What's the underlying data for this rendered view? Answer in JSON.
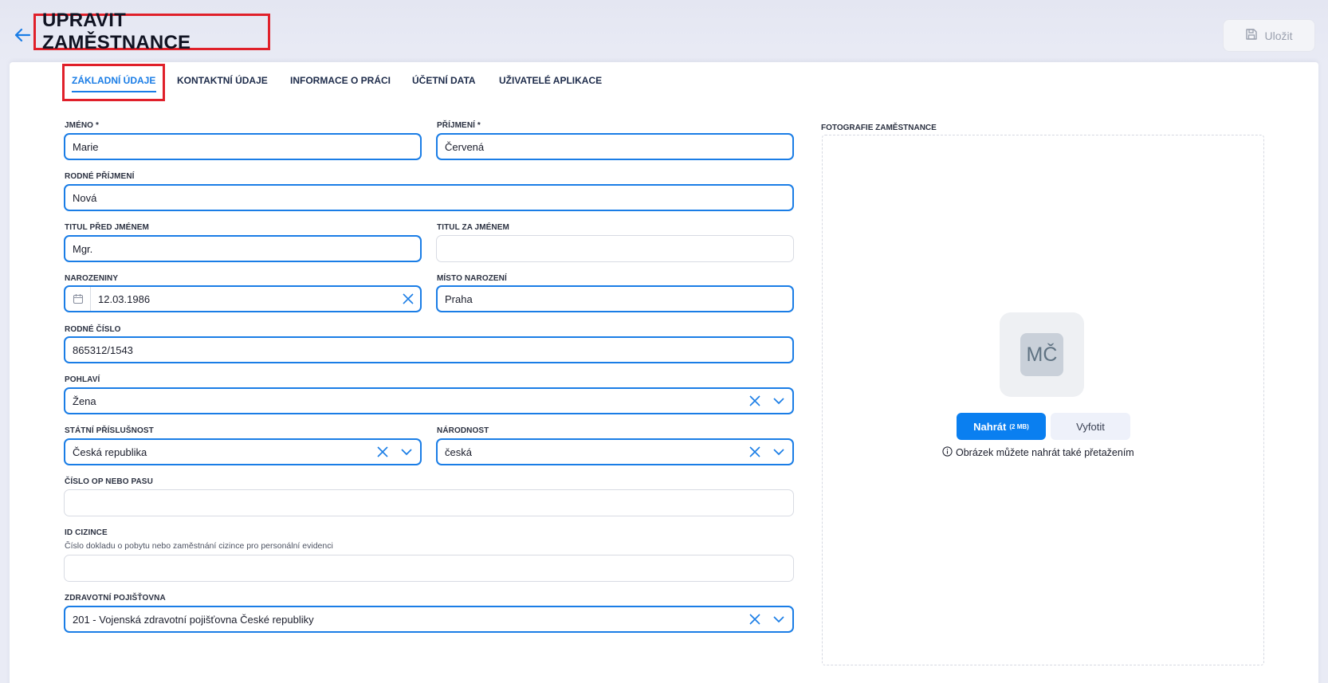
{
  "header": {
    "title": "UPRAVIT ZAMĚSTNANCE",
    "save_label": "Uložit"
  },
  "tabs": [
    {
      "label": "ZÁKLADNÍ ÚDAJE",
      "active": true
    },
    {
      "label": "KONTAKTNÍ ÚDAJE",
      "active": false
    },
    {
      "label": "INFORMACE O PRÁCI",
      "active": false
    },
    {
      "label": "ÚČETNÍ DATA",
      "active": false
    },
    {
      "label": "UŽIVATELÉ APLIKACE",
      "active": false
    }
  ],
  "form": {
    "first_name": {
      "label": "JMÉNO *",
      "value": "Marie"
    },
    "last_name": {
      "label": "PŘÍJMENÍ *",
      "value": "Červená"
    },
    "birth_surname": {
      "label": "RODNÉ PŘÍJMENÍ",
      "value": "Nová"
    },
    "title_before": {
      "label": "TITUL PŘED JMÉNEM",
      "value": "Mgr."
    },
    "title_after": {
      "label": "TITUL ZA JMÉNEM",
      "value": ""
    },
    "birthday": {
      "label": "NAROZENINY",
      "value": "12.03.1986"
    },
    "birthplace": {
      "label": "MÍSTO NAROZENÍ",
      "value": "Praha"
    },
    "birth_number": {
      "label": "RODNÉ ČÍSLO",
      "value": "865312/1543"
    },
    "gender": {
      "label": "POHLAVÍ",
      "value": "Žena"
    },
    "citizenship": {
      "label": "STÁTNÍ PŘÍSLUŠNOST",
      "value": "Česká republika"
    },
    "nationality": {
      "label": "NÁRODNOST",
      "value": "česká"
    },
    "id_number": {
      "label": "ČÍSLO OP NEBO PASU",
      "value": ""
    },
    "foreigner_id": {
      "label": "ID CIZINCE",
      "help": "Číslo dokladu o pobytu nebo zaměstnání cizince pro personální evidenci",
      "value": ""
    },
    "insurance": {
      "label": "ZDRAVOTNÍ POJIŠŤOVNA",
      "value": "201 - Vojenská zdravotní pojišťovna České republiky"
    }
  },
  "photo": {
    "label": "FOTOGRAFIE ZAMĚSTNANCE",
    "initials": "MČ",
    "upload_label": "Nahrát",
    "upload_limit": "(2 MB)",
    "camera_label": "Vyfotit",
    "drop_hint": "Obrázek můžete nahrát také přetažením"
  },
  "colors": {
    "accent": "#1a7de6",
    "highlight": "#e0202a",
    "primary_button": "#0a7ff0"
  }
}
